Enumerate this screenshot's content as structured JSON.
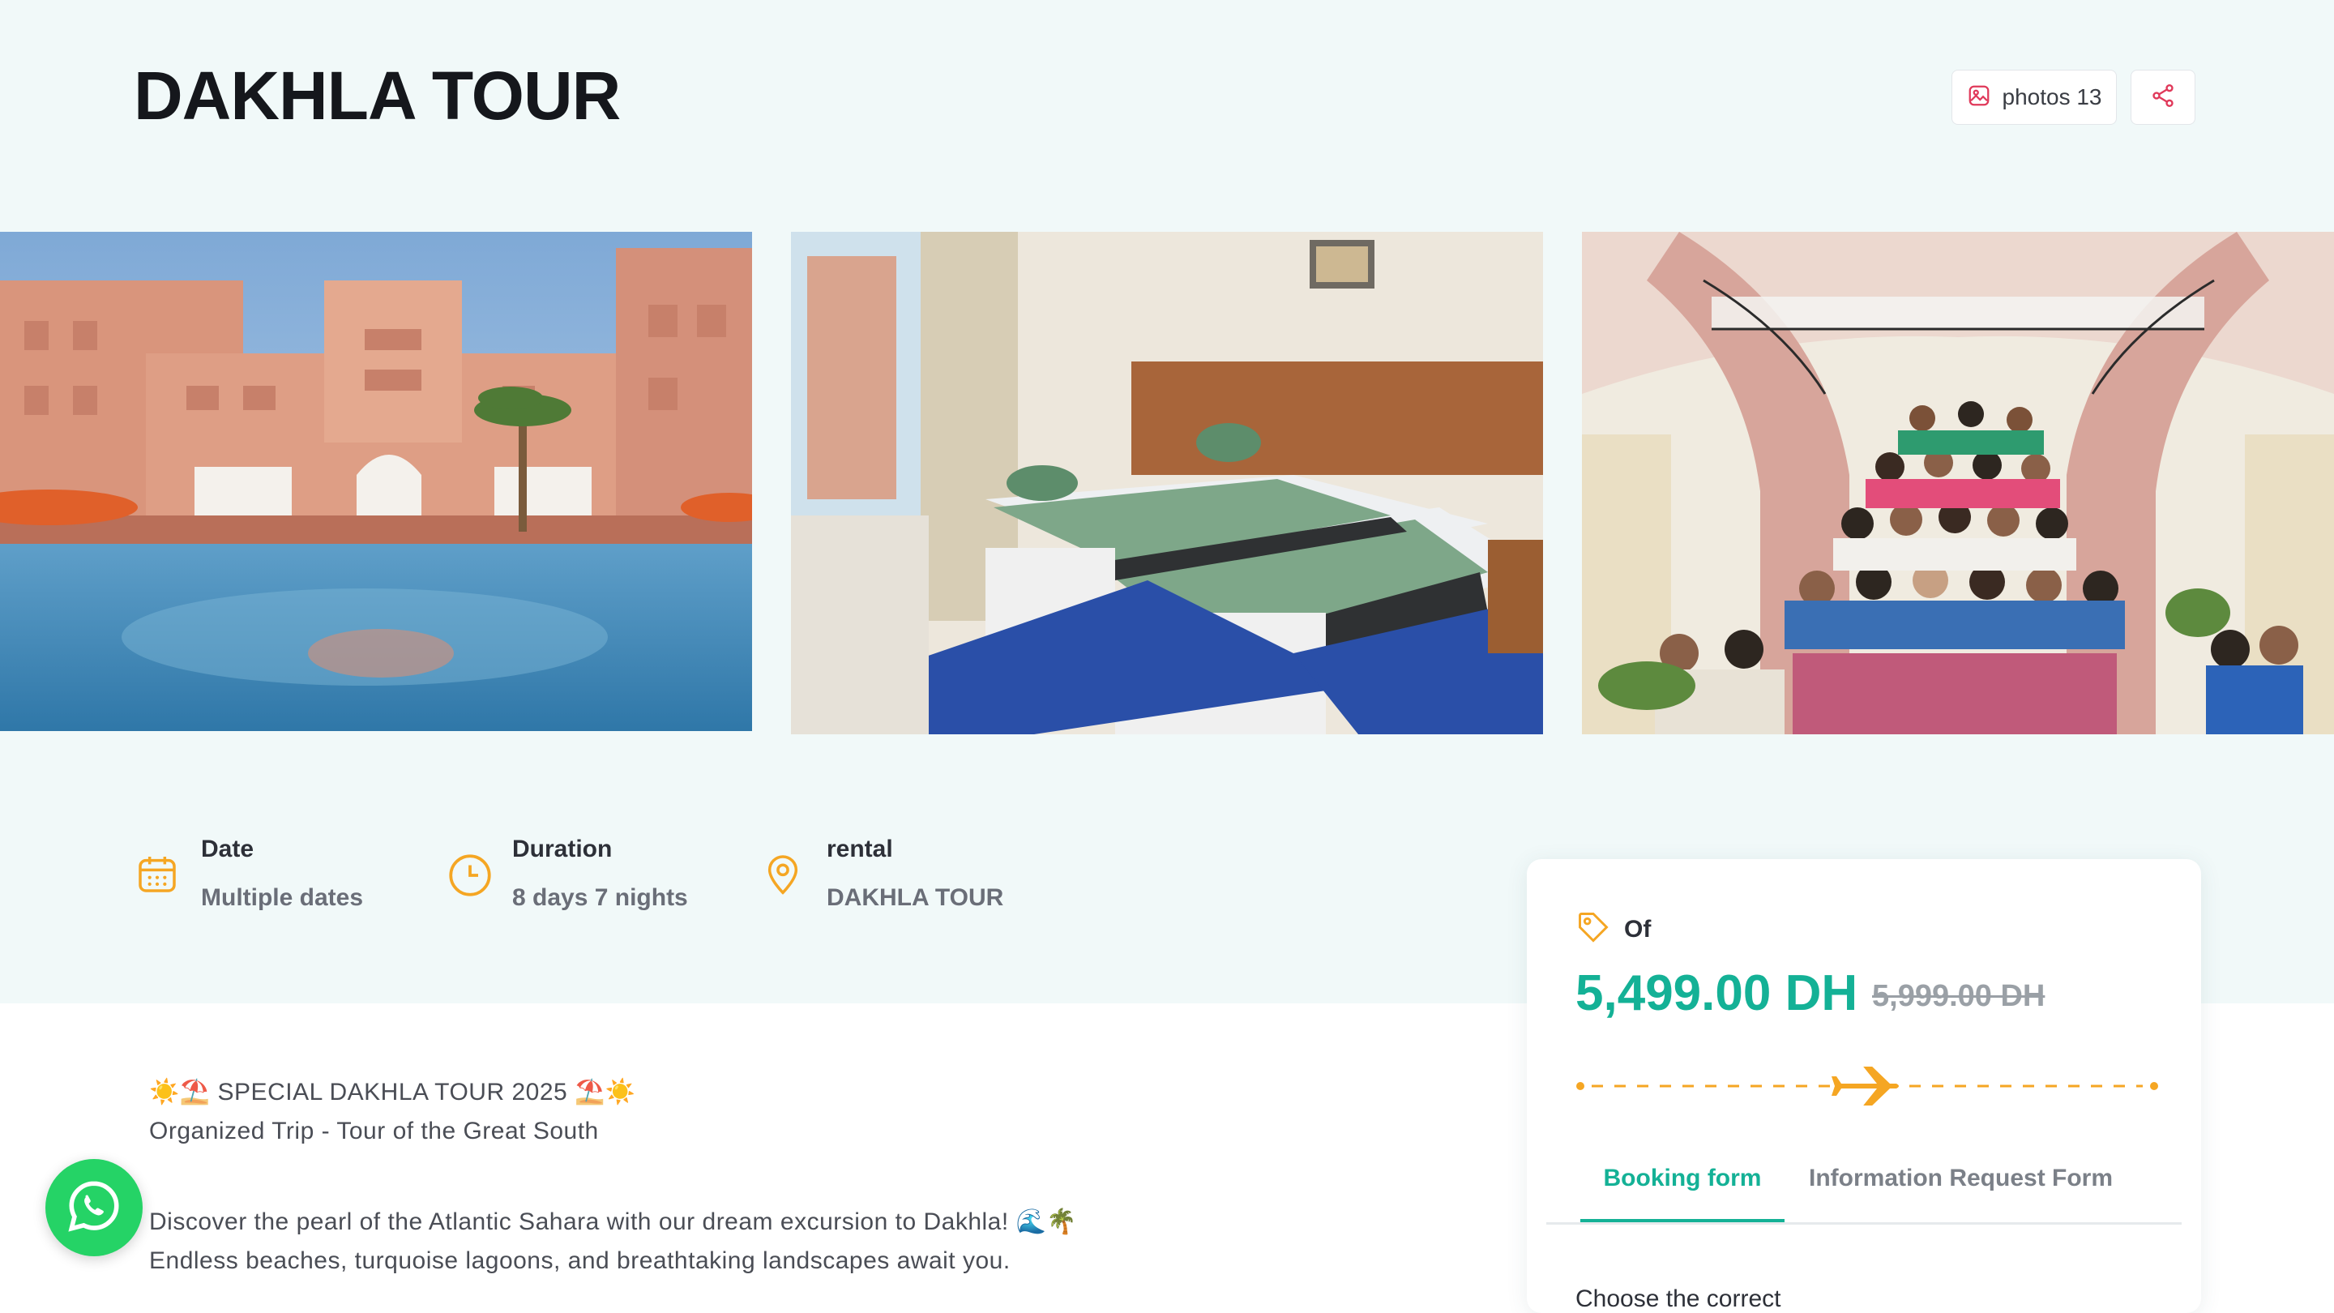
{
  "page": {
    "title": "DAKHLA TOUR"
  },
  "header_actions": {
    "photos_label": "photos 13",
    "photos_icon": "image-icon",
    "share_icon": "share-icon"
  },
  "gallery": [
    {
      "name": "hotel-pool-image",
      "alt": "Hotel exterior with pool"
    },
    {
      "name": "hotel-room-image",
      "alt": "Hotel twin room"
    },
    {
      "name": "group-photo-image",
      "alt": "Group on staircase"
    }
  ],
  "info": [
    {
      "key": "Date",
      "value": "Multiple dates",
      "icon": "calendar-icon"
    },
    {
      "key": "Duration",
      "value": "8 days 7 nights",
      "icon": "clock-icon"
    },
    {
      "key": "rental",
      "value": "DAKHLA TOUR",
      "icon": "location-pin-icon"
    }
  ],
  "booking": {
    "of_label": "Of",
    "price": "5,499.00 DH",
    "old_price": "5,999.00 DH",
    "tabs": [
      "Booking form",
      "Information Request Form"
    ],
    "cut_text": "Choose the correct"
  },
  "description": {
    "line1": "☀️⛱️ SPECIAL DAKHLA TOUR 2025 ⛱️☀️",
    "line2": "Organized Trip - Tour of the Great South",
    "line3": "Discover the pearl of the Atlantic Sahara with our dream excursion to Dakhla! 🌊🌴",
    "line4": "Endless beaches, turquoise lagoons, and breathtaking landscapes await you."
  },
  "colors": {
    "accent": "#14b196",
    "orange": "#f5a623",
    "hero_bg": "#f1f9f9",
    "red_icon": "#e0395a",
    "whatsapp": "#25d366"
  }
}
